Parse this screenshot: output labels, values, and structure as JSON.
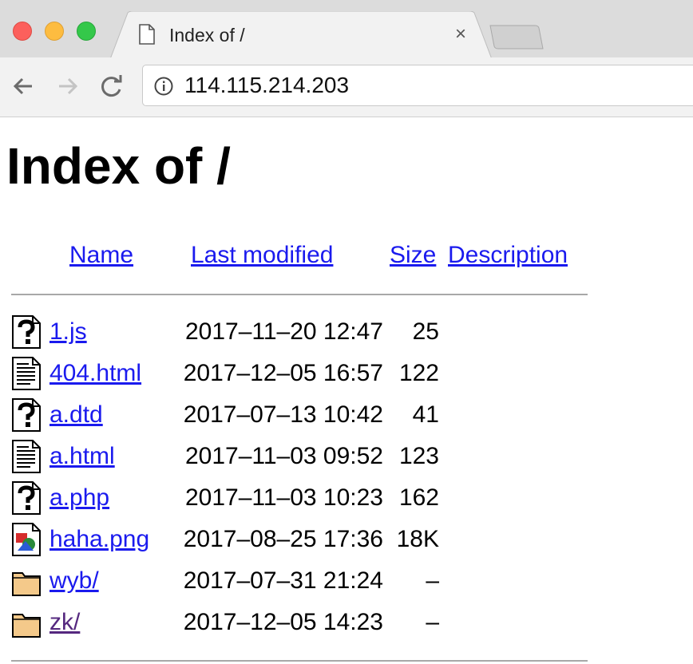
{
  "browser": {
    "tab_title": "Index of /",
    "tab_close": "×",
    "url": "114.115.214.203"
  },
  "page": {
    "heading": "Index of /",
    "columns": [
      "Name",
      "Last modified",
      "Size",
      "Description"
    ],
    "rows": [
      {
        "name": "1.js",
        "modified": "2017–11–20 12:47",
        "size": "25",
        "icon": "unknown-file-icon"
      },
      {
        "name": "404.html",
        "modified": "2017–12–05 16:57",
        "size": "122",
        "icon": "text-file-icon"
      },
      {
        "name": "a.dtd",
        "modified": "2017–07–13 10:42",
        "size": "41",
        "icon": "unknown-file-icon"
      },
      {
        "name": "a.html",
        "modified": "2017–11–03 09:52",
        "size": "123",
        "icon": "text-file-icon"
      },
      {
        "name": "a.php",
        "modified": "2017–11–03 10:23",
        "size": "162",
        "icon": "unknown-file-icon"
      },
      {
        "name": "haha.png",
        "modified": "2017–08–25 17:36",
        "size": "18K",
        "icon": "image-file-icon"
      },
      {
        "name": "wyb/",
        "modified": "2017–07–31 21:24",
        "size": "–",
        "icon": "folder-icon"
      },
      {
        "name": "zk/",
        "modified": "2017–12–05 14:23",
        "size": "–",
        "icon": "folder-icon",
        "visited": true
      }
    ]
  },
  "colors": {
    "link": "#1a1aee",
    "visited_link": "#55287f"
  }
}
